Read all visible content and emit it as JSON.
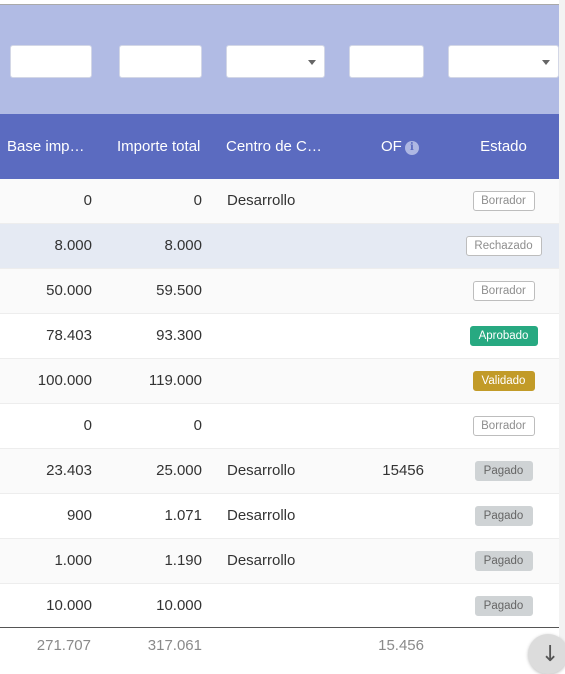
{
  "columns": {
    "base": "Base imp…",
    "total": "Importe total",
    "centro": "Centro de C…",
    "of": "OF",
    "estado": "Estado"
  },
  "rows": [
    {
      "base": "0",
      "total": "0",
      "centro": "Desarrollo",
      "of": "",
      "estado": "Borrador",
      "estado_style": "outline"
    },
    {
      "base": "8.000",
      "total": "8.000",
      "centro": "",
      "of": "",
      "estado": "Rechazado",
      "estado_style": "outline"
    },
    {
      "base": "50.000",
      "total": "59.500",
      "centro": "",
      "of": "",
      "estado": "Borrador",
      "estado_style": "outline"
    },
    {
      "base": "78.403",
      "total": "93.300",
      "centro": "",
      "of": "",
      "estado": "Aprobado",
      "estado_style": "green"
    },
    {
      "base": "100.000",
      "total": "119.000",
      "centro": "",
      "of": "",
      "estado": "Validado",
      "estado_style": "gold"
    },
    {
      "base": "0",
      "total": "0",
      "centro": "",
      "of": "",
      "estado": "Borrador",
      "estado_style": "outline"
    },
    {
      "base": "23.403",
      "total": "25.000",
      "centro": "Desarrollo",
      "of": "15456",
      "estado": "Pagado",
      "estado_style": "grey"
    },
    {
      "base": "900",
      "total": "1.071",
      "centro": "Desarrollo",
      "of": "",
      "estado": "Pagado",
      "estado_style": "grey"
    },
    {
      "base": "1.000",
      "total": "1.190",
      "centro": "Desarrollo",
      "of": "",
      "estado": "Pagado",
      "estado_style": "grey"
    },
    {
      "base": "10.000",
      "total": "10.000",
      "centro": "",
      "of": "",
      "estado": "Pagado",
      "estado_style": "grey"
    }
  ],
  "totals": {
    "base": "271.707",
    "total": "317.061",
    "of": "15.456"
  },
  "icons": {
    "info": "info-icon",
    "scroll": "arrow-down-icon",
    "dropdown": "chevron-down-icon"
  },
  "colors": {
    "header": "#5b6bc0",
    "filter_bar": "#b1bbe4",
    "approved": "#27a981",
    "validated": "#c29b28",
    "paid": "#cfd3d5"
  }
}
